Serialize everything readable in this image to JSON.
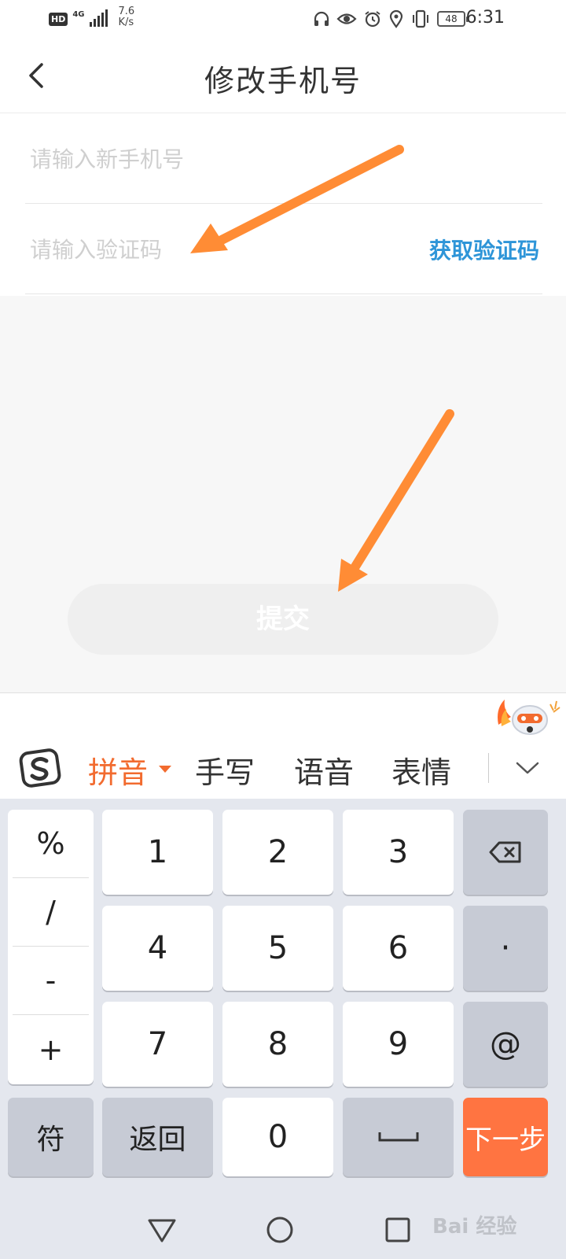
{
  "status_bar": {
    "hd": "HD",
    "network": "4G",
    "speed_value": "7.6",
    "speed_unit": "K/s",
    "battery": "48",
    "time": "6:31"
  },
  "header": {
    "title": "修改手机号"
  },
  "form": {
    "phone_placeholder": "请输入新手机号",
    "code_placeholder": "请输入验证码",
    "get_code_label": "获取验证码"
  },
  "submit_label": "提交",
  "keyboard": {
    "tabs": [
      "拼音",
      "手写",
      "语音",
      "表情"
    ],
    "symbols": [
      "%",
      "/",
      "-",
      "+"
    ],
    "digits": [
      "1",
      "2",
      "3",
      "4",
      "5",
      "6",
      "7",
      "8",
      "9",
      "0"
    ],
    "right_keys": {
      "dot": "·",
      "at": "@"
    },
    "bottom": {
      "symbols": "符",
      "back": "返回",
      "next": "下一步"
    }
  },
  "watermark": "Bai 经验",
  "colors": {
    "accent_orange": "#ff7441",
    "link_blue": "#2e95d8",
    "arrow": "#ff8c35"
  }
}
